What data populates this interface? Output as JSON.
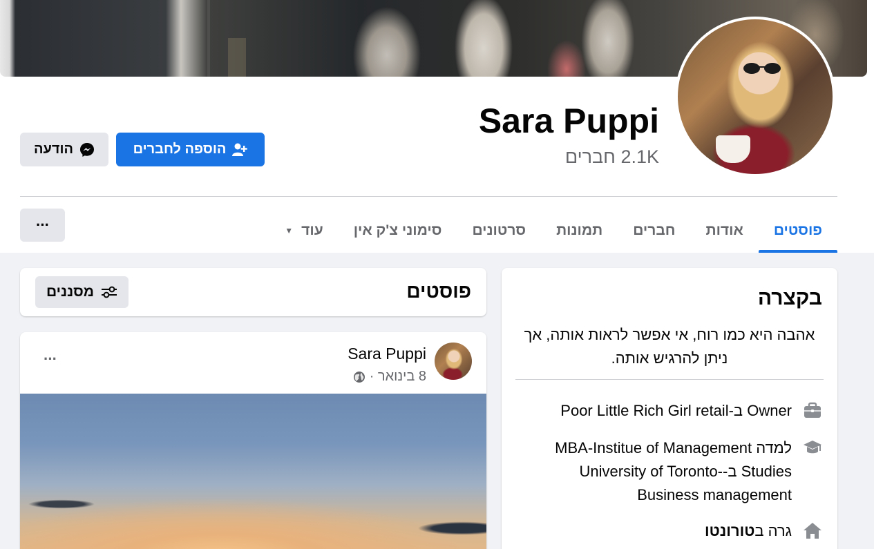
{
  "profile": {
    "name": "Sara Puppi",
    "friends_count": "2.1K חברים"
  },
  "actions": {
    "add_friend_label": "הוספה לחברים",
    "message_label": "הודעה"
  },
  "tabs": [
    {
      "label": "פוסטים",
      "active": true
    },
    {
      "label": "אודות",
      "active": false
    },
    {
      "label": "חברים",
      "active": false
    },
    {
      "label": "תמונות",
      "active": false
    },
    {
      "label": "סרטונים",
      "active": false
    },
    {
      "label": "סימוני צ'ק אין",
      "active": false
    },
    {
      "label": "עוד",
      "active": false
    }
  ],
  "more_button": "···",
  "intro": {
    "title": "בקצרה",
    "bio": "אהבה היא כמו רוח, אי אפשר לראות אותה, אך ניתן להרגיש אותה.",
    "work": "Owner ב-Poor Little Rich Girl retail",
    "education": "למדה MBA-Institue of Management Studies ב-University of Toronto- Business management",
    "lives_prefix": "גרה ב",
    "lives_city": "טורונטו"
  },
  "posts_section": {
    "title": "פוסטים",
    "filters_label": "מסננים"
  },
  "post": {
    "author": "Sara Puppi",
    "date": "8 בינואר ·",
    "more": "···"
  },
  "icons": {
    "add_friend": "person-plus-icon",
    "message": "messenger-icon",
    "filters": "sliders-icon",
    "work": "briefcase-icon",
    "education": "graduation-cap-icon",
    "home": "home-icon",
    "privacy": "globe-icon"
  },
  "colors": {
    "accent": "#1b74e4",
    "secondary_text": "#65676b",
    "button_gray": "#e4e6eb",
    "page_bg": "#f0f2f5"
  }
}
